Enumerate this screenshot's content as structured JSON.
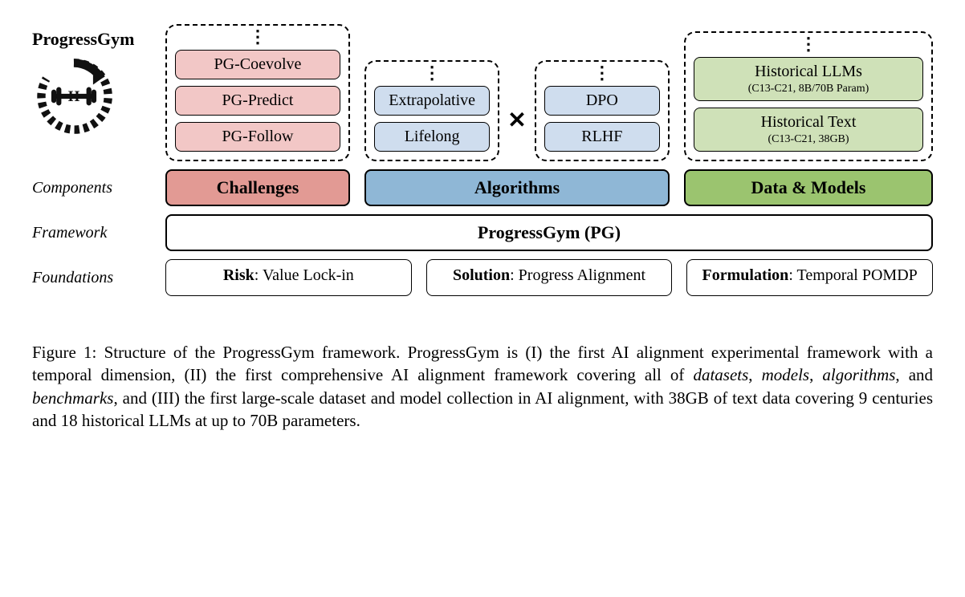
{
  "header": {
    "title": "ProgressGym"
  },
  "row_labels": {
    "components": "Components",
    "framework": "Framework",
    "foundations": "Foundations"
  },
  "challenges": {
    "items": [
      "PG-Coevolve",
      "PG-Predict",
      "PG-Follow"
    ]
  },
  "algorithms": {
    "colA": [
      "Extrapolative",
      "Lifelong"
    ],
    "colB": [
      "DPO",
      "RLHF"
    ],
    "op": "✕"
  },
  "data_models": {
    "items": [
      {
        "label": "Historical LLMs",
        "sub": "(C13-C21, 8B/70B Param)"
      },
      {
        "label": "Historical Text",
        "sub": "(C13-C21, 38GB)"
      }
    ]
  },
  "components_bar": {
    "challenges": "Challenges",
    "algorithms": "Algorithms",
    "data_models": "Data & Models"
  },
  "framework_bar": "ProgressGym (PG)",
  "foundations": {
    "risk": {
      "k": "Risk",
      "v": ": Value Lock-in"
    },
    "solution": {
      "k": "Solution",
      "v": ": Progress Alignment"
    },
    "formulation": {
      "k": "Formulation",
      "v": ": Temporal POMDP"
    }
  },
  "caption": {
    "prefix": "Figure 1:  Structure of the ProgressGym framework.  ProgressGym is (I) the first AI alignment experimental framework with a temporal dimension, (II) the first comprehensive AI alignment framework covering all of ",
    "em1": "datasets",
    "c1": ", ",
    "em2": "models",
    "c2": ", ",
    "em3": "algorithms",
    "c3": ", and ",
    "em4": "benchmarks",
    "suffix": ", and (III) the first large-scale dataset and model collection in AI alignment, with 38GB of text data covering 9 centuries and 18 historical LLMs at up to 70B parameters."
  }
}
